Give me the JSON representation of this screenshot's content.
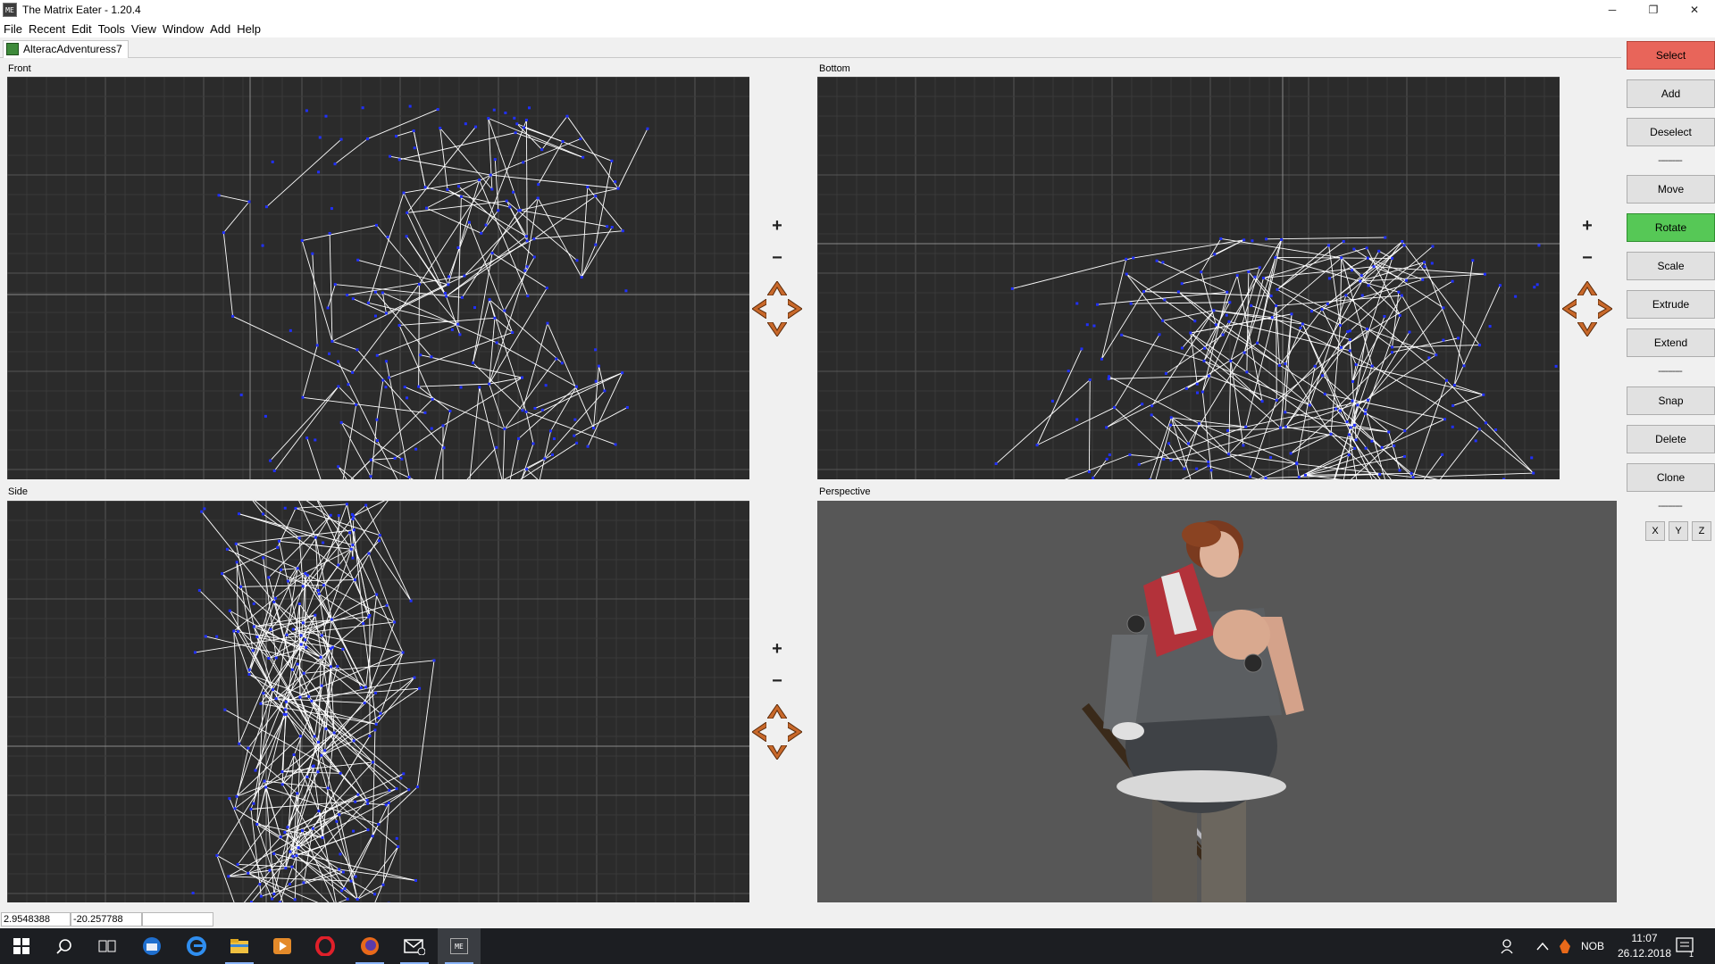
{
  "window": {
    "title": "The Matrix Eater - 1.20.4",
    "icon_text": "ME",
    "controls": {
      "minimize": "─",
      "restore": "❐",
      "close": "✕"
    }
  },
  "menu": [
    "File",
    "Recent",
    "Edit",
    "Tools",
    "View",
    "Window",
    "Add",
    "Help"
  ],
  "document_tab": {
    "label": "AlteracAdventuress7"
  },
  "viewports": {
    "front": {
      "label": "Front"
    },
    "bottom": {
      "label": "Bottom"
    },
    "side": {
      "label": "Side"
    },
    "perspective": {
      "label": "Perspective"
    }
  },
  "nav": {
    "zoom_in": "+",
    "zoom_out": "−"
  },
  "toolbar": {
    "select": "Select",
    "add": "Add",
    "deselect": "Deselect",
    "separator": "----------",
    "move": "Move",
    "rotate": "Rotate",
    "scale": "Scale",
    "extrude": "Extrude",
    "extend": "Extend",
    "snap": "Snap",
    "delete": "Delete",
    "clone": "Clone",
    "axis_x": "X",
    "axis_y": "Y",
    "axis_z": "Z"
  },
  "status": {
    "coord_x": "2.9548388",
    "coord_y": "-20.257788",
    "coord_z": ""
  },
  "taskbar": {
    "tray_language": "NOB",
    "time": "11:07",
    "date": "26.12.2018",
    "notification_count": "1"
  },
  "colors": {
    "select_active": "#e8655a",
    "rotate_active": "#56c856",
    "viewport_bg": "#2b2b2b",
    "perspective_bg": "#575757",
    "nav_arrow": "#c8682a"
  }
}
